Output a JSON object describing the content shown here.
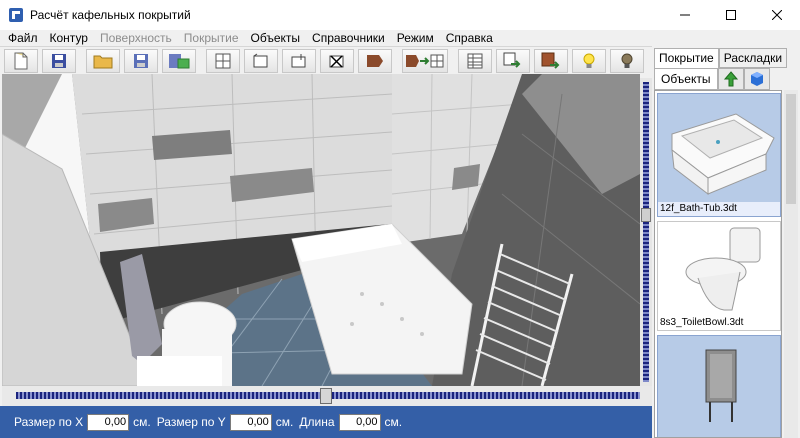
{
  "window": {
    "title": "Расчёт кафельных покрытий"
  },
  "menu": [
    {
      "label": "Файл",
      "disabled": false
    },
    {
      "label": "Контур",
      "disabled": false
    },
    {
      "label": "Поверхность",
      "disabled": true
    },
    {
      "label": "Покрытие",
      "disabled": true
    },
    {
      "label": "Объекты",
      "disabled": false
    },
    {
      "label": "Справочники",
      "disabled": false
    },
    {
      "label": "Режим",
      "disabled": false
    },
    {
      "label": "Справка",
      "disabled": false
    }
  ],
  "toolbar": {
    "buttons": [
      "new-file-icon",
      "save-disk-icon",
      "open-folder-icon",
      "save-disk-icon",
      "image-export-icon",
      "grid-icon",
      "select-rect-icon",
      "add-rect-icon",
      "delete-rect-icon",
      "tile-icon",
      "tile-apply-icon",
      "table-icon",
      "export-icon",
      "texture-export-icon",
      "light-on-icon",
      "light-off-icon"
    ]
  },
  "status": {
    "size_x_label": "Размер по X",
    "size_x_value": "0,00",
    "size_y_label": "Размер по Y",
    "size_y_value": "0,00",
    "length_label": "Длина",
    "length_value": "0,00",
    "unit": "см."
  },
  "panel": {
    "tab_coverage": "Покрытие",
    "tab_layouts": "Раскладки",
    "tab_objects": "Объекты",
    "items": [
      {
        "caption": "12f_Bath-Tub.3dt",
        "selected": true
      },
      {
        "caption": "8s3_ToiletBowl.3dt",
        "selected": false
      },
      {
        "caption": "",
        "selected": false
      }
    ]
  },
  "colors": {
    "accent": "#345fa7",
    "slider": "#1a237e"
  }
}
